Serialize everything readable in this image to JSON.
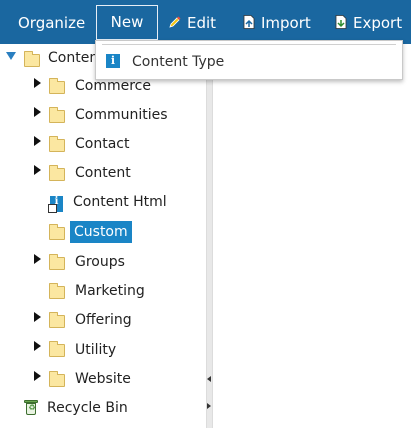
{
  "toolbar": {
    "organize": "Organize",
    "new": "New",
    "edit": "Edit",
    "import": "Import",
    "export": "Export"
  },
  "dropdown": {
    "items": [
      {
        "label": "Content Type",
        "icon": "info-icon"
      }
    ]
  },
  "tree": {
    "root": {
      "label": "Conten",
      "expanded": true
    },
    "children": [
      {
        "label": "Commerce",
        "has_children": true
      },
      {
        "label": "Communities",
        "has_children": true
      },
      {
        "label": "Contact",
        "has_children": true
      },
      {
        "label": "Content",
        "has_children": true
      },
      {
        "label": "Content Html",
        "has_children": false,
        "icon": "content-item-icon"
      },
      {
        "label": "Custom",
        "has_children": false,
        "selected": true
      },
      {
        "label": "Groups",
        "has_children": true
      },
      {
        "label": "Marketing",
        "has_children": false
      },
      {
        "label": "Offering",
        "has_children": true
      },
      {
        "label": "Utility",
        "has_children": true
      },
      {
        "label": "Website",
        "has_children": true
      }
    ],
    "recycle_bin": "Recycle Bin"
  },
  "colors": {
    "toolbar_bg": "#1a67a0",
    "selection": "#1a85c6",
    "folder": "#fbe7a1"
  }
}
